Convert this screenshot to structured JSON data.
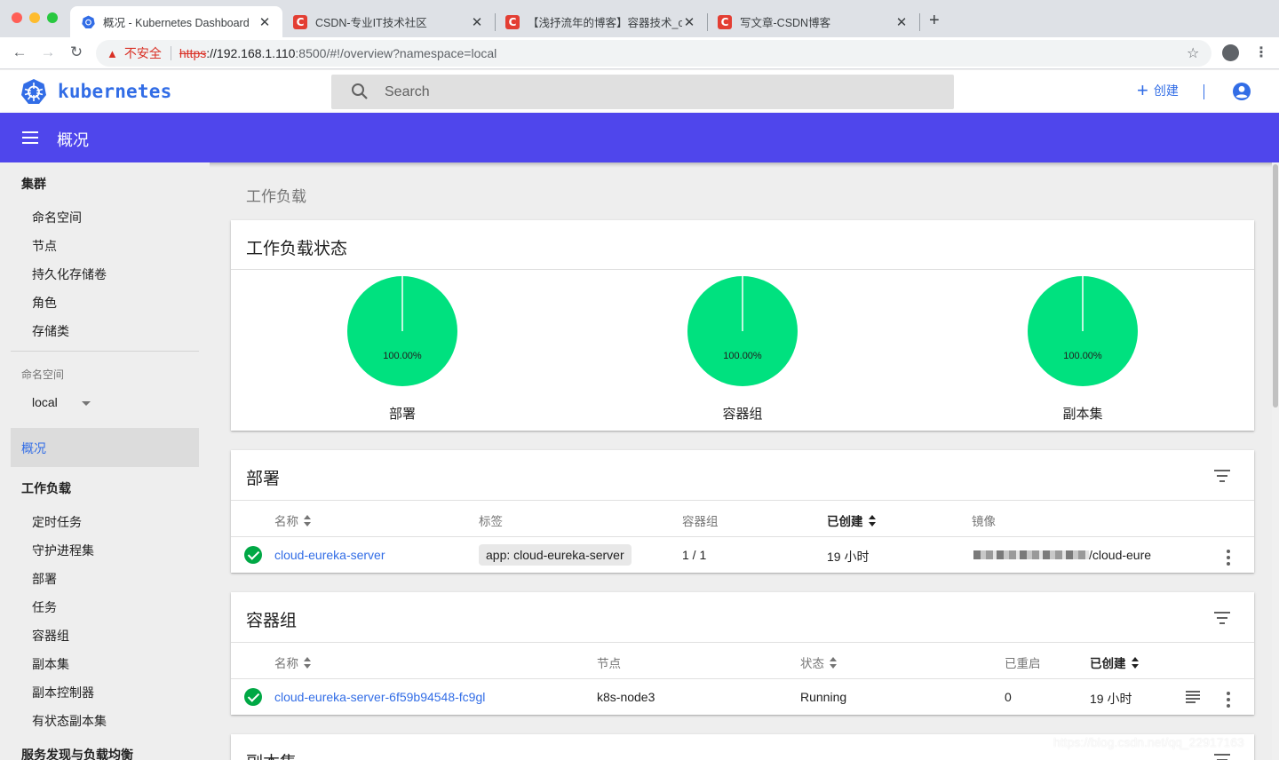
{
  "browser": {
    "tabs": [
      {
        "title": "概况 - Kubernetes Dashboard",
        "active": true
      },
      {
        "title": "CSDN-专业IT技术社区",
        "active": false
      },
      {
        "title": "【浅抒流年的博客】容器技术_or",
        "active": false
      },
      {
        "title": "写文章-CSDN博客",
        "active": false
      }
    ],
    "new_tab": "+",
    "security_text": "不安全",
    "url_proto": "https",
    "url_host": "://192.168.1.110",
    "url_path": ":8500/#!/overview?namespace=local"
  },
  "header": {
    "brand": "kubernetes",
    "search_placeholder": "Search",
    "create_label": "创建"
  },
  "toolbar": {
    "title": "概况"
  },
  "sidebar": {
    "cluster_title": "集群",
    "cluster_items": [
      "命名空间",
      "节点",
      "持久化存储卷",
      "角色",
      "存储类"
    ],
    "namespace_label": "命名空间",
    "namespace_value": "local",
    "overview": "概况",
    "workloads_title": "工作负载",
    "workload_items": [
      "定时任务",
      "守护进程集",
      "部署",
      "任务",
      "容器组",
      "副本集",
      "副本控制器",
      "有状态副本集"
    ],
    "discovery_title": "服务发现与负载均衡"
  },
  "main": {
    "breadcrumb": "工作负载",
    "status_card": {
      "title": "工作负载状态",
      "charts": [
        {
          "label": "部署",
          "percent": "100.00%"
        },
        {
          "label": "容器组",
          "percent": "100.00%"
        },
        {
          "label": "副本集",
          "percent": "100.00%"
        }
      ]
    },
    "deployments": {
      "title": "部署",
      "columns": [
        "名称",
        "标签",
        "容器组",
        "已创建",
        "镜像"
      ],
      "row": {
        "name": "cloud-eureka-server",
        "label": "app: cloud-eureka-server",
        "pods": "1 / 1",
        "created": "19 小时",
        "image": "/cloud-eure"
      }
    },
    "pods": {
      "title": "容器组",
      "columns": [
        "名称",
        "节点",
        "状态",
        "已重启",
        "已创建"
      ],
      "row": {
        "name": "cloud-eureka-server-6f59b94548-fc9gl",
        "node": "k8s-node3",
        "status": "Running",
        "restarts": "0",
        "created": "19 小时"
      }
    },
    "replicasets": {
      "title": "副本集"
    }
  },
  "watermark": "https://blog.csdn.net/qq_22917163",
  "colors": {
    "primary": "#326de6",
    "toolbar": "#4f46ec",
    "pie_success": "#00e17f",
    "status_ok": "#00a845"
  }
}
